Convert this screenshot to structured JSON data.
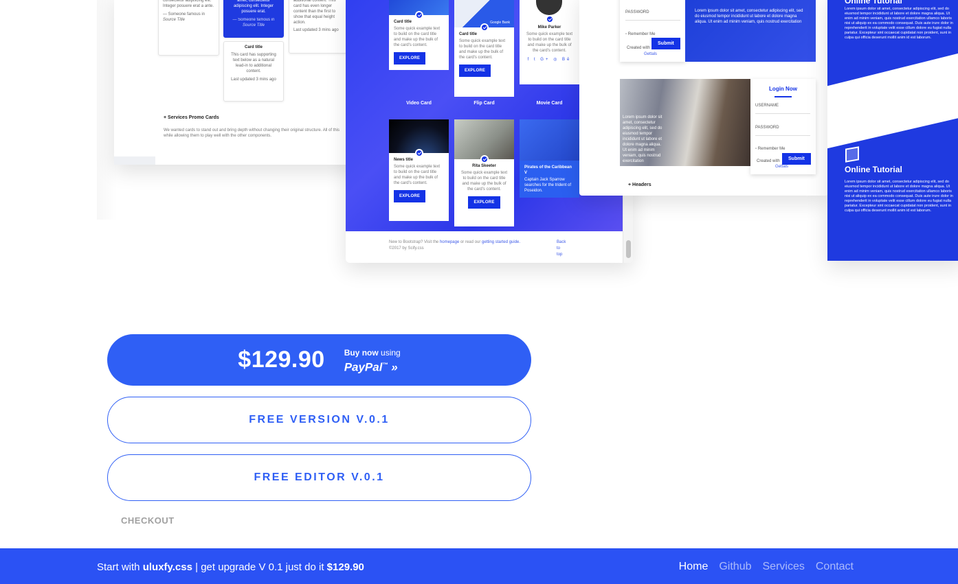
{
  "showcase": {
    "left_panel": {
      "quote_card": {
        "text": "consectetur adipiscing elit. Integer posuere erat a ante.",
        "source": "— Someone famous in",
        "source_title": "Source Title"
      },
      "blue_quote_card": {
        "text": "amet, consectetur adipiscing elit. Integer posuere erat.",
        "source": "— Someone famous in",
        "source_title": "Source Title"
      },
      "text_card_top": {
        "text": "additional content. This card has even longer content than the first to show that equal height action.",
        "updated": "Last updated 3 mins ago"
      },
      "card_bottom": {
        "title": "Card title",
        "text": "This card has supporting text below as a natural lead-in to additional content.",
        "updated": "Last updated 3 mins ago"
      },
      "services_title": "+ Services Promo Cards",
      "services_desc": "We wanted cards to stand out and bring depth without changing their original structure. All of this while allowing them to play well with the other components."
    },
    "center_panel": {
      "cards": [
        {
          "title": "Card title",
          "text": "Some quick example text to build on the card title and make up the bulk of the card's content.",
          "button": "EXPLORE"
        },
        {
          "title": "Card title",
          "text": "Some quick example text to build on the card title and make up the bulk of the card's content.",
          "button": "EXPLORE",
          "image_caption": "Google Bank"
        },
        {
          "title": "Mike Parker",
          "text": "Some quick example text to build on the card title and make up the bulk of the card's content."
        },
        {
          "title": "News title",
          "text": "Some quick example text to build on the card title and make up the bulk of the card's content.",
          "button": "EXPLORE"
        },
        {
          "title": "Rita Skeeter",
          "text": "Some quick example text to build on the card title and make up the bulk of the card's content.",
          "button": "EXPLORE"
        },
        {
          "title": "Pirates of the Caribbean V",
          "text": "Captain Jack Sparrow searches for the trident of Poseidon."
        }
      ],
      "labels": [
        "Video Card",
        "Flip Card",
        "Movie Card"
      ],
      "footer_line1_a": "New to Bootstrap? Visit the",
      "footer_link1": "homepage",
      "footer_line1_b": "or read our",
      "footer_link2": "getting started guide.",
      "footer_line2": "©2017 by Scify.css",
      "back_to_top": "Back to top"
    },
    "right_panel": {
      "login1": {
        "password_label": "PASSWORD",
        "remember": "Remember Me",
        "created": "Created with",
        "created_by": "Gettals",
        "submit": "Submit"
      },
      "blue_text": "Lorem ipsum dolor sit amet, consectetur adipiscing elit, sed do eiusmod tempor incididunt ut labore et dolore magna aliqua. Ut enim ad minim veniam, quis nostrud exercitation",
      "photo_text": "Lorem ipsum dolor sit amet, consectetur adipiscing elit, sed do eiusmod tempor incididunt ut labore et dolore magna aliqua. Ut enim ad minim veniam, quis nostrud exercitation",
      "login2": {
        "title": "Login Now",
        "username_label": "USERNAME",
        "password_label": "PASSWORD",
        "remember": "Remember Me",
        "created": "Created with",
        "created_by": "Gettals",
        "submit": "Submit"
      },
      "headers_label": "+ Headers"
    },
    "far_right": {
      "title_top": "Online Tutorial",
      "text_top": "Lorem ipsum dolor sit amet, consectetur adipiscing elit, sed do eiusmod tempor incididunt ut labore et dolore magna aliqua. Ut enim ad minim veniam, quis nostrud exercitation ullamco laboris nisi ut aliquip ex ea commodo consequat. Duis aute irure dolor in reprehenderit in voluptate velit esse cillum dolore eu fugiat nulla pariatur. Excepteur sint occaecat cupidatat non proident, sunt in culpa qui officia deserunt mollit anim id est laborum.",
      "title_bottom": "Online Tutorial",
      "text_bottom": "Lorem ipsum dolor sit amet, consectetur adipiscing elit, sed do eiusmod tempor incididunt ut labore et dolore magna aliqua. Ut enim ad minim veniam, quis nostrud exercitation ullamco laboris nisi ut aliquip ex ea commodo consequat. Duis aute irure dolor in reprehenderit in voluptate velit esse cillum dolore eu fugiat nulla pariatur. Excepteur sint occaecat cupidatat non proident, sunt in culpa qui officia deserunt mollit anim id est laborum."
    }
  },
  "purchase": {
    "price": "$129.90",
    "buy_now": "Buy now",
    "using": "using",
    "paypal": "PayPal",
    "paypal_arrows": "»",
    "free_version": "FREE VERSION V.0.1",
    "free_editor": "FREE EDITOR V.0.1",
    "checkout": "CHECKOUT"
  },
  "footer": {
    "start_with": "Start with",
    "brand": "uluxfy.css",
    "middle": "| get upgrade V 0.1 just do it",
    "price": "$129.90",
    "nav": [
      "Home",
      "Github",
      "Services",
      "Contact"
    ],
    "active_nav": "Home"
  },
  "colors": {
    "primary": "#2b52f4",
    "button_blue": "#2f5ff5",
    "checkout_gray": "#a0a0a0"
  }
}
